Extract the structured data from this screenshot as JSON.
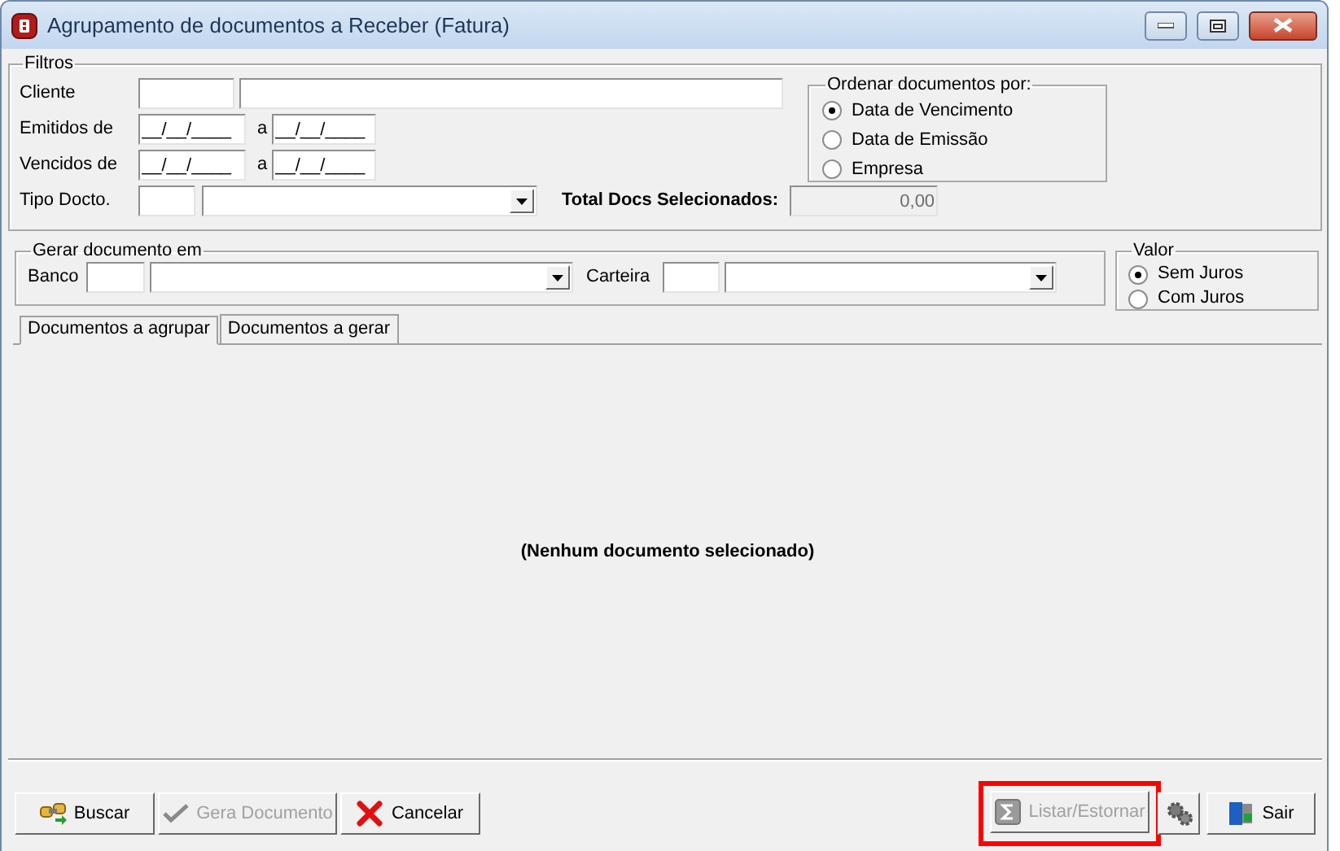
{
  "window": {
    "title": "Agrupamento de documentos a Receber (Fatura)"
  },
  "filters": {
    "legend": "Filtros",
    "rows": [
      {
        "kind": "pair",
        "label": "Cliente"
      },
      {
        "kind": "dates",
        "label": "Emitidos de",
        "from": "__/__/____",
        "sep": "a",
        "to": "__/__/____"
      },
      {
        "kind": "dates",
        "label": "Vencidos de",
        "from": "__/__/____",
        "sep": "a",
        "to": "__/__/____"
      }
    ],
    "type_row": {
      "label": "Tipo Docto."
    },
    "total": {
      "label": "Total Docs Selecionados:",
      "value": "0,00"
    },
    "order": {
      "legend": "Ordenar documentos por:",
      "options": [
        {
          "label": "Data de Vencimento",
          "selected": true
        },
        {
          "label": "Data de Emissão",
          "selected": false
        },
        {
          "label": "Empresa",
          "selected": false
        }
      ]
    }
  },
  "generate": {
    "legend": "Gerar documento em",
    "bank_label": "Banco",
    "wallet_label": "Carteira"
  },
  "value": {
    "legend": "Valor",
    "options": [
      {
        "label": "Sem Juros",
        "selected": true
      },
      {
        "label": "Com Juros",
        "selected": false
      }
    ]
  },
  "tabs": [
    {
      "label": "Documentos a agrupar",
      "selected": true
    },
    {
      "label": "Documentos a gerar",
      "selected": false
    }
  ],
  "empty_message": "(Nenhum documento selecionado)",
  "left_buttons": [
    {
      "label": "Buscar",
      "disabled": false
    },
    {
      "label": "Gera Documento",
      "disabled": true
    },
    {
      "label": "Cancelar",
      "disabled": false
    }
  ],
  "right_buttons": [
    {
      "label": "Listar/Estornar",
      "disabled": true,
      "highlighted": true
    },
    {
      "highlighted": false
    },
    {
      "label": "Sair",
      "disabled": false,
      "highlighted": false
    }
  ]
}
